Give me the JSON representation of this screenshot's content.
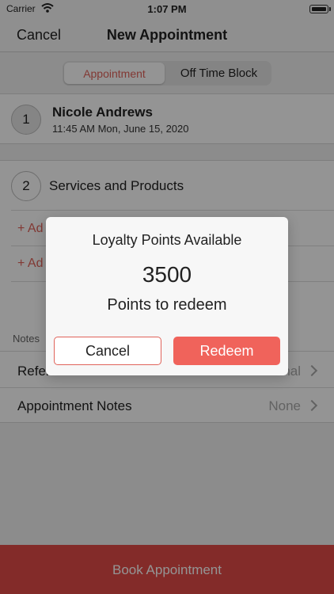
{
  "status_bar": {
    "carrier": "Carrier",
    "time": "1:07 PM"
  },
  "nav": {
    "cancel_label": "Cancel",
    "title": "New Appointment"
  },
  "segment": {
    "options": [
      "Appointment",
      "Off Time Block"
    ],
    "selected": "Appointment"
  },
  "client": {
    "step": "1",
    "name": "Nicole Andrews",
    "datetime": "11:45 AM Mon, June 15, 2020"
  },
  "services": {
    "step": "2",
    "title": "Services and Products",
    "add_links": [
      "+ Ad",
      "+ Ad"
    ]
  },
  "notes": {
    "header": "Notes",
    "rows": [
      {
        "label": "Refer",
        "value": "nal"
      },
      {
        "label": "Appointment Notes",
        "value": "None"
      }
    ]
  },
  "book_button": {
    "label": "Book Appointment"
  },
  "modal": {
    "title": "Loyalty Points Available",
    "points": "3500",
    "subtitle": "Points to redeem",
    "cancel_label": "Cancel",
    "redeem_label": "Redeem"
  },
  "colors": {
    "accent": "#e0635a",
    "book_button": "#e24b47",
    "redeem_button": "#f0635b"
  }
}
